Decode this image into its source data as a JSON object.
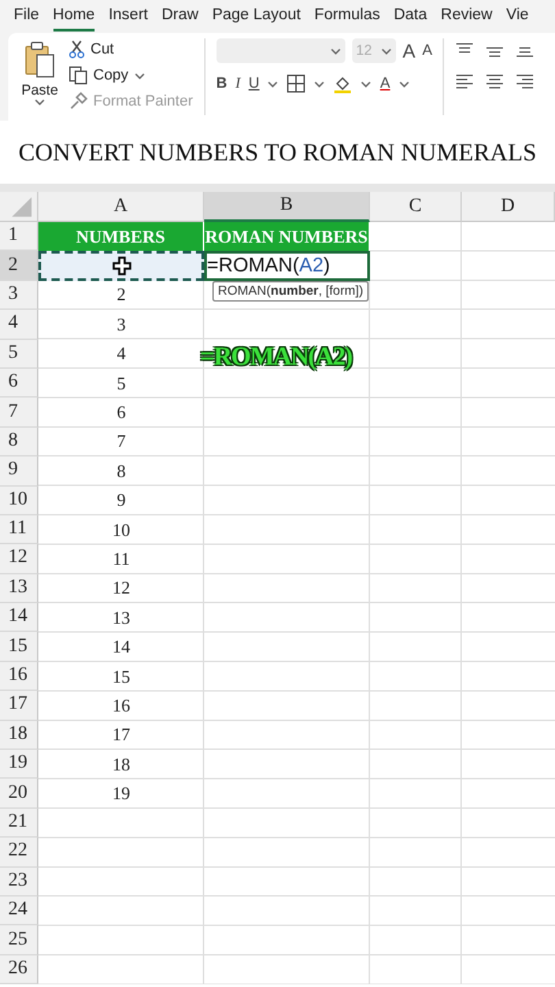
{
  "menu_tabs": [
    {
      "label": "File",
      "selected": false
    },
    {
      "label": "Home",
      "selected": true
    },
    {
      "label": "Insert",
      "selected": false
    },
    {
      "label": "Draw",
      "selected": false
    },
    {
      "label": "Page Layout",
      "selected": false
    },
    {
      "label": "Formulas",
      "selected": false
    },
    {
      "label": "Data",
      "selected": false
    },
    {
      "label": "Review",
      "selected": false
    },
    {
      "label": "Vie",
      "selected": false
    }
  ],
  "clipboard": {
    "paste": "Paste",
    "cut": "Cut",
    "copy": "Copy",
    "format_painter": "Format Painter",
    "format_painter_disabled": true
  },
  "font": {
    "size": "12",
    "grow": "A",
    "shrink": "A",
    "bold": "B",
    "italic": "I",
    "underline": "U",
    "font_color_label": "A"
  },
  "title": "CONVERT NUMBERS TO ROMAN NUMERALS",
  "columns": [
    {
      "label": "A",
      "selected": false
    },
    {
      "label": "B",
      "selected": true
    },
    {
      "label": "C",
      "selected": false
    },
    {
      "label": "D",
      "selected": false
    }
  ],
  "rows": [
    {
      "header": "1",
      "selected": false,
      "kind": "heading",
      "a": "NUMBERS",
      "b": "ROMAN NUMBERS"
    },
    {
      "header": "2",
      "selected": true,
      "kind": "editing",
      "b_formula": [
        {
          "text": "=ROMAN(",
          "reference": false
        },
        {
          "text": "A2",
          "reference": true
        },
        {
          "text": ")",
          "reference": false
        }
      ],
      "tooltip": "ROMAN(**number**, [form])"
    },
    {
      "header": "3",
      "selected": false,
      "kind": "data",
      "a": "2"
    },
    {
      "header": "4",
      "selected": false,
      "kind": "data",
      "a": "3"
    },
    {
      "header": "5",
      "selected": false,
      "kind": "data",
      "a": "4"
    },
    {
      "header": "6",
      "selected": false,
      "kind": "data",
      "a": "5"
    },
    {
      "header": "7",
      "selected": false,
      "kind": "data",
      "a": "6"
    },
    {
      "header": "8",
      "selected": false,
      "kind": "data",
      "a": "7"
    },
    {
      "header": "9",
      "selected": false,
      "kind": "data",
      "a": "8"
    },
    {
      "header": "10",
      "selected": false,
      "kind": "data",
      "a": "9"
    },
    {
      "header": "11",
      "selected": false,
      "kind": "data",
      "a": "10"
    },
    {
      "header": "12",
      "selected": false,
      "kind": "data",
      "a": "11"
    },
    {
      "header": "13",
      "selected": false,
      "kind": "data",
      "a": "12"
    },
    {
      "header": "14",
      "selected": false,
      "kind": "data",
      "a": "13"
    },
    {
      "header": "15",
      "selected": false,
      "kind": "data",
      "a": "14"
    },
    {
      "header": "16",
      "selected": false,
      "kind": "data",
      "a": "15"
    },
    {
      "header": "17",
      "selected": false,
      "kind": "data",
      "a": "16"
    },
    {
      "header": "18",
      "selected": false,
      "kind": "data",
      "a": "17"
    },
    {
      "header": "19",
      "selected": false,
      "kind": "data",
      "a": "18"
    },
    {
      "header": "20",
      "selected": false,
      "kind": "data",
      "a": "19"
    },
    {
      "header": "21",
      "selected": false,
      "kind": "data"
    },
    {
      "header": "22",
      "selected": false,
      "kind": "data"
    },
    {
      "header": "23",
      "selected": false,
      "kind": "data"
    },
    {
      "header": "24",
      "selected": false,
      "kind": "data"
    },
    {
      "header": "25",
      "selected": false,
      "kind": "data"
    },
    {
      "header": "26",
      "selected": false,
      "kind": "data"
    }
  ],
  "overlay_caption": "=ROMAN(A2)"
}
